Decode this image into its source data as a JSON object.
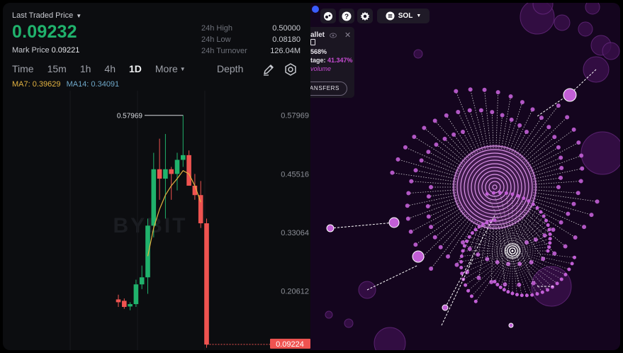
{
  "ticker": {
    "last_traded_label": "Last Traded Price",
    "price": "0.09232",
    "mark_label": "Mark Price",
    "mark_value": "0.09221",
    "stats": [
      {
        "key": "24h High",
        "value": "0.50000"
      },
      {
        "key": "24h Low",
        "value": "0.08180"
      },
      {
        "key": "24h Turnover",
        "value": "126.04M"
      }
    ]
  },
  "timeframes": [
    {
      "label": "Time",
      "active": false
    },
    {
      "label": "15m",
      "active": false
    },
    {
      "label": "1h",
      "active": false
    },
    {
      "label": "4h",
      "active": false
    },
    {
      "label": "1D",
      "active": true
    },
    {
      "label": "More",
      "active": false
    }
  ],
  "depth_label": "Depth",
  "ma": {
    "ma7": "MA7: 0.39629",
    "ma14": "MA14: 0.34091"
  },
  "watermark": "BYBIT",
  "colors": {
    "up": "#20b26c",
    "down": "#ef5350",
    "ma7": "#e3b341",
    "ma14": "#6fa8c9",
    "bubble": "#c25fd6"
  },
  "chart_data": {
    "type": "candlestick",
    "ylim": [
      0.08,
      0.62
    ],
    "y_ticks": [
      "0.57969",
      "0.45516",
      "0.33064",
      "0.20612"
    ],
    "y_tick_values": [
      0.57969,
      0.45516,
      0.33064,
      0.20612
    ],
    "high_label": "0.57969",
    "high_value": 0.57969,
    "current_label": "0.09224",
    "current_value": 0.09224,
    "candles": [
      {
        "o": 0.188,
        "h": 0.198,
        "l": 0.172,
        "c": 0.182
      },
      {
        "o": 0.185,
        "h": 0.19,
        "l": 0.168,
        "c": 0.172
      },
      {
        "o": 0.173,
        "h": 0.182,
        "l": 0.165,
        "c": 0.178
      },
      {
        "o": 0.178,
        "h": 0.23,
        "l": 0.172,
        "c": 0.22
      },
      {
        "o": 0.22,
        "h": 0.26,
        "l": 0.21,
        "c": 0.235
      },
      {
        "o": 0.235,
        "h": 0.36,
        "l": 0.2,
        "c": 0.345
      },
      {
        "o": 0.345,
        "h": 0.5,
        "l": 0.32,
        "c": 0.465
      },
      {
        "o": 0.465,
        "h": 0.53,
        "l": 0.4,
        "c": 0.445
      },
      {
        "o": 0.445,
        "h": 0.54,
        "l": 0.36,
        "c": 0.465
      },
      {
        "o": 0.465,
        "h": 0.47,
        "l": 0.4,
        "c": 0.455
      },
      {
        "o": 0.455,
        "h": 0.5,
        "l": 0.42,
        "c": 0.485
      },
      {
        "o": 0.485,
        "h": 0.58,
        "l": 0.47,
        "c": 0.495
      },
      {
        "o": 0.495,
        "h": 0.505,
        "l": 0.43,
        "c": 0.43
      },
      {
        "o": 0.43,
        "h": 0.455,
        "l": 0.4,
        "c": 0.41
      },
      {
        "o": 0.41,
        "h": 0.44,
        "l": 0.34,
        "c": 0.35
      },
      {
        "o": 0.35,
        "h": 0.36,
        "l": 0.085,
        "c": 0.092
      }
    ],
    "ma7_points": [
      [
        5,
        0.28
      ],
      [
        6,
        0.34
      ],
      [
        7,
        0.38
      ],
      [
        8,
        0.41
      ],
      [
        9,
        0.43
      ],
      [
        10,
        0.445
      ],
      [
        11,
        0.462
      ],
      [
        12,
        0.455
      ],
      [
        13,
        0.43
      ],
      [
        14,
        0.395
      ]
    ]
  },
  "bubblemap": {
    "card": {
      "title": "allet",
      "line2": "568%",
      "line3_label": "tage:",
      "line3_value": "41.347%",
      "line4": "volume",
      "button": "ANSFERS"
    },
    "token_label": "SOL",
    "icons": [
      "bubblemap-logo-icon",
      "help-icon",
      "settings-icon"
    ]
  }
}
